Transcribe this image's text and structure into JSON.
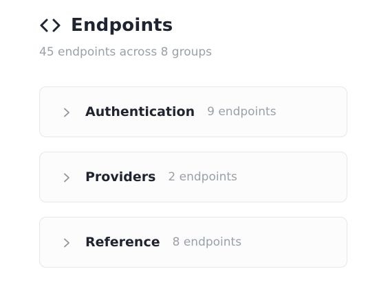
{
  "header": {
    "icon": "code-brackets-icon",
    "title": "Endpoints",
    "subtitle": "45 endpoints across 8 groups"
  },
  "groups": [
    {
      "name": "Authentication",
      "count": "9 endpoints"
    },
    {
      "name": "Providers",
      "count": "2 endpoints"
    },
    {
      "name": "Reference",
      "count": "8 endpoints"
    }
  ],
  "colors": {
    "text": "#1f2430",
    "muted": "#9aa0a8",
    "border": "#e6e7ea"
  }
}
